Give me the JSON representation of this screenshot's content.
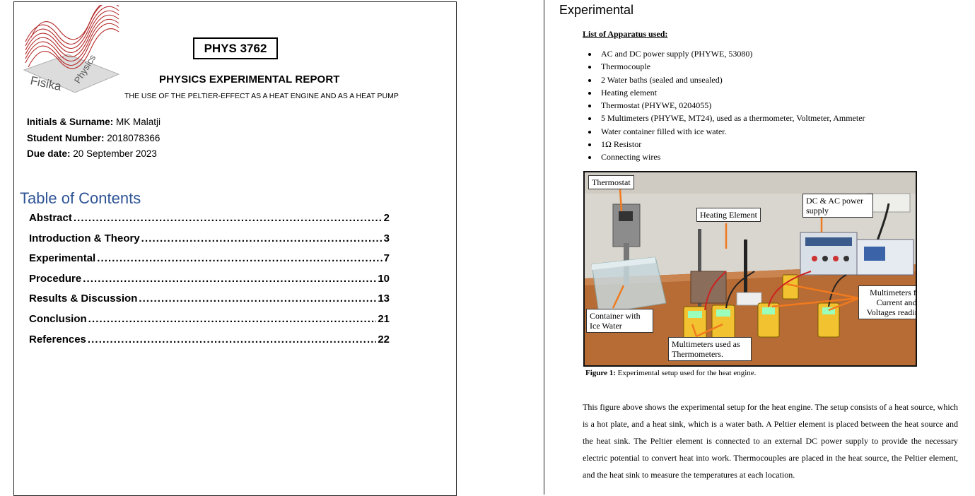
{
  "left_page": {
    "logo": {
      "text_fisika": "Fisika",
      "text_physics": "Physics",
      "accent_color": "#b52a2a"
    },
    "course_code": "PHYS 3762",
    "report_title": "PHYSICS EXPERIMENTAL REPORT",
    "report_subtitle": "THE USE OF THE PELTIER-EFFECT AS A HEAT ENGINE AND AS A HEAT PUMP",
    "student": {
      "name_label": "Initials & Surname:",
      "name_value": "MK Malatji",
      "number_label": "Student Number:",
      "number_value": "2018078366",
      "due_label": "Due date:",
      "due_value": "20 September 2023"
    },
    "toc_heading": "Table of Contents",
    "toc_color": "#2f5496",
    "toc": [
      {
        "title": "Abstract",
        "page": "2"
      },
      {
        "title": "Introduction & Theory",
        "page": "3"
      },
      {
        "title": "Experimental",
        "page": "7"
      },
      {
        "title": "Procedure",
        "page": "10"
      },
      {
        "title": "Results & Discussion",
        "page": "13"
      },
      {
        "title": "Conclusion",
        "page": "21"
      },
      {
        "title": "References",
        "page": "22"
      }
    ]
  },
  "right_page": {
    "section_heading": "Experimental",
    "apparatus_heading": "List of Apparatus used:",
    "apparatus": [
      "AC and DC power supply (PHYWE, 53080)",
      "Thermocouple",
      "2 Water baths (sealed and unsealed)",
      "Heating element",
      "Thermostat (PHYWE, 0204055)",
      "5 Multimeters (PHYWE, MT24), used as a thermometer, Voltmeter, Ammeter",
      "Water container filled with ice water.",
      "1Ω  Resistor",
      "Connecting wires"
    ],
    "photo_callouts": {
      "thermostat": "Thermostat",
      "heating_element": "Heating Element",
      "power_supply": "DC & AC power supply",
      "multimeters_readings": "Multimeters for Current and Voltages readings",
      "container": "Container with Ice Water",
      "multimeters_thermo": "Multimeters used as Thermometers."
    },
    "figure_caption_label": "Figure 1:",
    "figure_caption_text": "Experimental setup used for the heat engine.",
    "body_text": "This figure above shows the experimental setup for the heat engine. The setup consists of a heat source, which is a hot plate, and a heat sink, which is a water bath. A Peltier element is placed between the heat source and the heat sink. The Peltier element is connected to an external DC power supply to provide the necessary electric potential to convert heat into work. Thermocouples are placed in the heat source, the Peltier element, and the heat sink to measure the temperatures at each location."
  }
}
